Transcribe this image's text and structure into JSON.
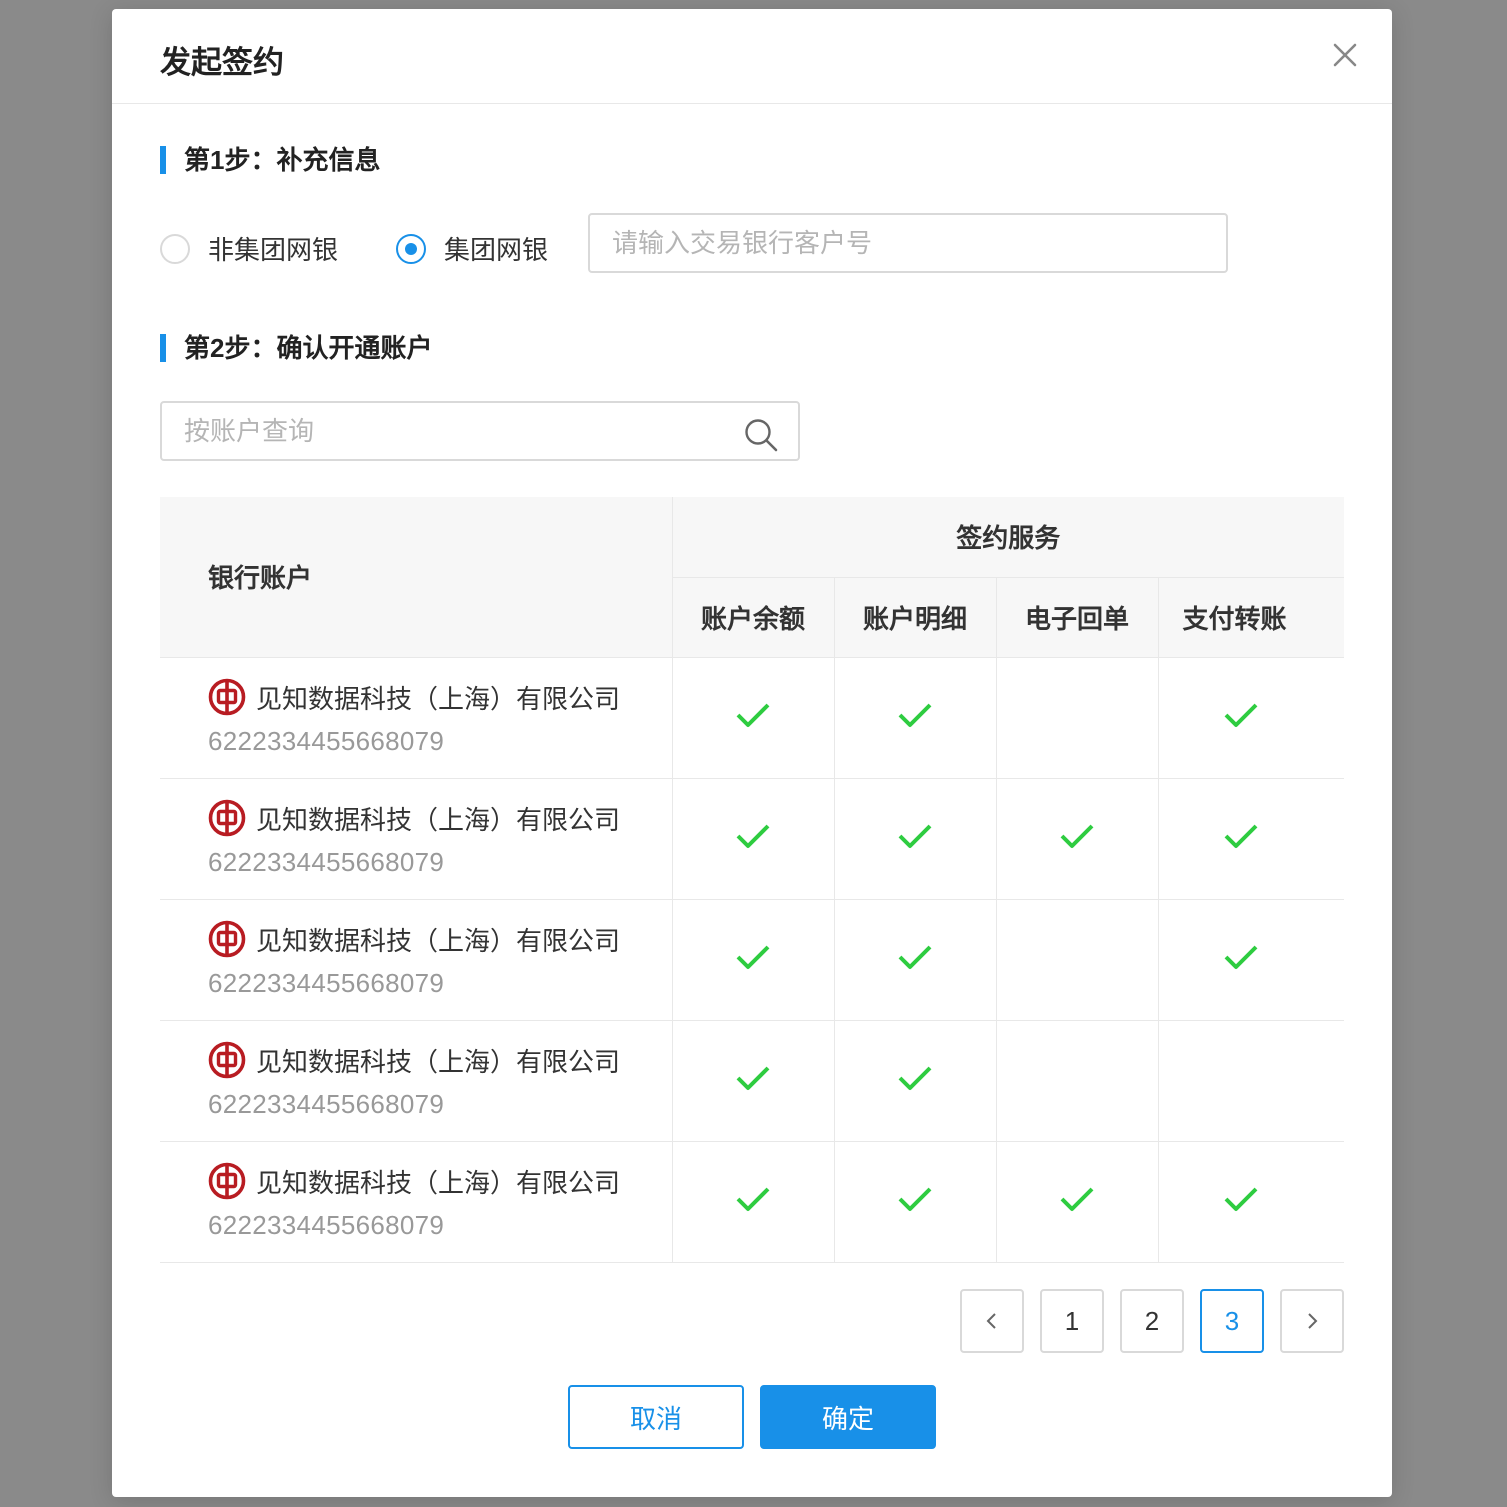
{
  "dialog": {
    "title": "发起签约"
  },
  "step1": {
    "title": "第1步：补充信息",
    "options": [
      {
        "label": "非集团网银",
        "checked": false
      },
      {
        "label": "集团网银",
        "checked": true
      }
    ],
    "customer_input_placeholder": "请输入交易银行客户号",
    "customer_input_value": ""
  },
  "step2": {
    "title": "第2步：确认开通账户",
    "search_placeholder": "按账户查询",
    "search_value": ""
  },
  "table": {
    "account_header": "银行账户",
    "services_header": "签约服务",
    "service_columns": [
      "账户余额",
      "账户明细",
      "电子回单",
      "支付转账"
    ],
    "rows": [
      {
        "name": "见知数据科技（上海）有限公司",
        "number": "6222334455668079",
        "services": [
          true,
          true,
          false,
          true
        ]
      },
      {
        "name": "见知数据科技（上海）有限公司",
        "number": "6222334455668079",
        "services": [
          true,
          true,
          true,
          true
        ]
      },
      {
        "name": "见知数据科技（上海）有限公司",
        "number": "6222334455668079",
        "services": [
          true,
          true,
          false,
          true
        ]
      },
      {
        "name": "见知数据科技（上海）有限公司",
        "number": "6222334455668079",
        "services": [
          true,
          true,
          false,
          false
        ]
      },
      {
        "name": "见知数据科技（上海）有限公司",
        "number": "6222334455668079",
        "services": [
          true,
          true,
          true,
          true
        ]
      }
    ]
  },
  "pagination": {
    "pages": [
      "1",
      "2",
      "3"
    ],
    "current": "3"
  },
  "footer": {
    "cancel_label": "取消",
    "confirm_label": "确定"
  },
  "colors": {
    "primary": "#1890e8",
    "check": "#2ecc40",
    "bank_logo": "#b81c22",
    "overlay": "#8a8a8a"
  },
  "icons": {
    "close": "close-icon",
    "search": "search-icon",
    "bank": "bank-of-china-icon",
    "check": "check-icon",
    "prev": "chevron-left-icon",
    "next": "chevron-right-icon"
  }
}
